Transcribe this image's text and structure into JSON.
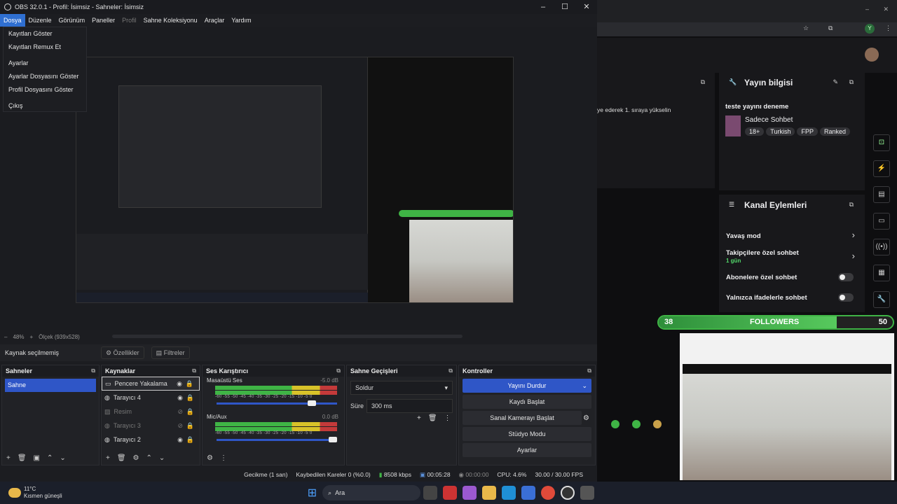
{
  "obs": {
    "title": "OBS 32.0.1 - Profil: İsimsiz - Sahneler: İsimsiz",
    "menu": [
      "Dosya",
      "Düzenle",
      "Görünüm",
      "Paneller",
      "Profil",
      "Sahne Koleksiyonu",
      "Araçlar",
      "Yardım"
    ],
    "file_menu": [
      "Kayıtları Göster",
      "Kayıtları Remux Et",
      "Ayarlar",
      "Ayarlar Dosyasını Göster",
      "Profil Dosyasını Göster",
      "Çıkış"
    ],
    "zoom": "48%",
    "canvas_size": "Ölçek (939x528)",
    "source_status": "Kaynak seçilmemiş",
    "properties_btn": "Özellikler",
    "filters_btn": "Filtreler",
    "scenes": {
      "title": "Sahneler",
      "items": [
        "Sahne"
      ]
    },
    "sources": {
      "title": "Kaynaklar",
      "items": [
        {
          "name": "Pencere Yakalama",
          "icon": "window-icon",
          "visible": true,
          "selected": true
        },
        {
          "name": "Tarayıcı 4",
          "icon": "globe-icon",
          "visible": true
        },
        {
          "name": "Resim",
          "icon": "image-icon",
          "visible": false
        },
        {
          "name": "Tarayıcı 3",
          "icon": "globe-icon",
          "visible": false
        },
        {
          "name": "Tarayıcı 2",
          "icon": "globe-icon",
          "visible": true
        }
      ]
    },
    "mixer": {
      "title": "Ses Karıştırıcı",
      "channels": [
        {
          "name": "Masaüstü Ses",
          "db": "-5.0 dB",
          "level": 0.8
        },
        {
          "name": "Mic/Aux",
          "db": "0.0 dB",
          "level": 1.0
        }
      ],
      "scale": "-60 -55 -50 -45 -40 -35 -30 -25 -20 -15 -10 -5 0"
    },
    "transitions": {
      "title": "Sahne Geçişleri",
      "type": "Soldur",
      "duration_label": "Süre",
      "duration": "300 ms"
    },
    "controls": {
      "title": "Kontroller",
      "buttons": [
        "Yayını Durdur",
        "Kaydı Başlat",
        "Sanal Kamerayı Başlat",
        "Stüdyo Modu",
        "Ayarlar"
      ]
    },
    "status": {
      "delay": "Gecikme (1 san)",
      "dropped": "Kaybedilen Kareler 0 (%0.0)",
      "bitrate": "8508 kbps",
      "stream_time": "00:05:28",
      "rec_time": "00:00:00",
      "cpu": "CPU: 4.6%",
      "fps": "30.00 / 30.00 FPS"
    }
  },
  "browser": {
    "chat_hint": "ye ederek 1. sıraya yükselin",
    "stream_info": {
      "title": "Yayın bilgisi",
      "stream_title": "teste yayını deneme",
      "category": "Sadece Sohbet",
      "tags": [
        "18+",
        "Turkish",
        "FPP",
        "Ranked"
      ]
    },
    "channel_actions": {
      "title": "Kanal Eylemleri",
      "items": [
        {
          "label": "Yavaş mod",
          "sub": ""
        },
        {
          "label": "Takipçilere özel sohbet",
          "sub": "1 gün"
        },
        {
          "label": "Abonelere özel sohbet",
          "sub": ""
        },
        {
          "label": "Yalnızca ifadelerle sohbet",
          "sub": ""
        }
      ]
    },
    "followers": {
      "current": "38",
      "label": "FOLLOWERS",
      "goal": "50",
      "progress": 0.76
    }
  },
  "taskbar": {
    "temp": "11°C",
    "weather": "Kısmen güneşli",
    "search": "Ara"
  }
}
